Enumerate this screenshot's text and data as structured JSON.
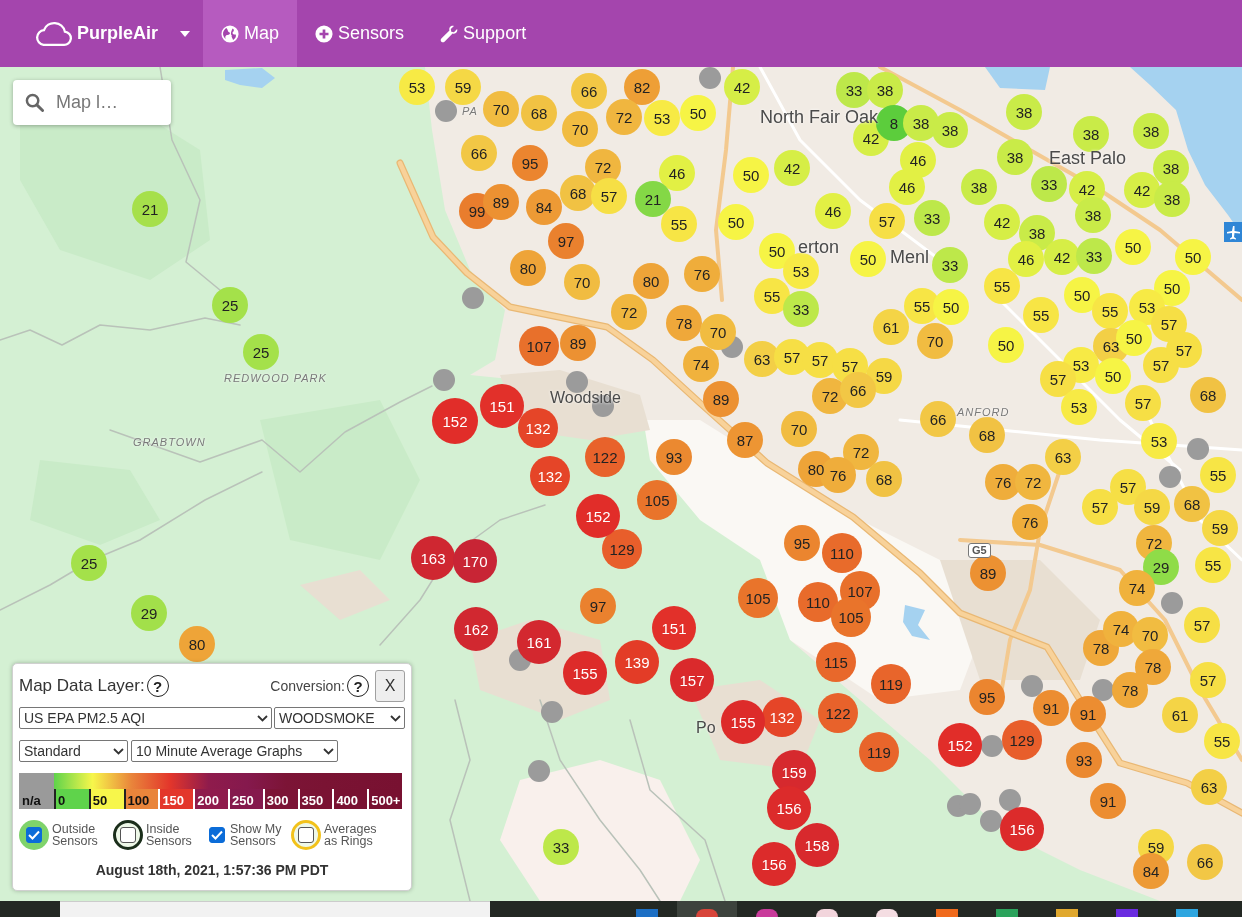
{
  "navbar": {
    "brand": "PurpleAir",
    "links": [
      {
        "label": "Map",
        "selected": true
      },
      {
        "label": "Sensors",
        "selected": false
      },
      {
        "label": "Support",
        "selected": false
      }
    ]
  },
  "search": {
    "placeholder": "Map l…"
  },
  "map": {
    "places": [
      {
        "label": "North Fair Oak",
        "kind": "city"
      },
      {
        "label": "East Palo",
        "kind": "city"
      },
      {
        "label": "erton",
        "kind": "city"
      },
      {
        "label": "Menl",
        "kind": "city"
      },
      {
        "label": "Woodside",
        "kind": "town"
      },
      {
        "label": "Po",
        "kind": "town"
      },
      {
        "label": "PA",
        "kind": "area"
      },
      {
        "label": "REDWOOD PARK",
        "kind": "area"
      },
      {
        "label": "GRABTOWN",
        "kind": "area"
      },
      {
        "label": "ANFORD",
        "kind": "area"
      }
    ],
    "route_shield": "G5",
    "markers": [
      {
        "kind": "reading",
        "reading": "53",
        "color": "#f7ea45"
      },
      {
        "kind": "reading",
        "reading": "59",
        "color": "#f5d845"
      },
      {
        "kind": "reading",
        "reading": "66",
        "color": "#f2c745"
      },
      {
        "kind": "reading",
        "reading": "82",
        "color": "#ee9f36"
      },
      {
        "kind": "offline"
      },
      {
        "kind": "reading",
        "reading": "42",
        "color": "#d6ee46"
      },
      {
        "kind": "reading",
        "reading": "33",
        "color": "#bde84a"
      },
      {
        "kind": "reading",
        "reading": "38",
        "color": "#c9eb48"
      },
      {
        "kind": "offline"
      },
      {
        "kind": "reading",
        "reading": "70",
        "color": "#f1bc41"
      },
      {
        "kind": "reading",
        "reading": "68",
        "color": "#f1c243"
      },
      {
        "kind": "reading",
        "reading": "72",
        "color": "#f0b63f"
      },
      {
        "kind": "reading",
        "reading": "53",
        "color": "#f7ea45"
      },
      {
        "kind": "reading",
        "reading": "50",
        "color": "#f6f445"
      },
      {
        "kind": "reading",
        "reading": "38",
        "color": "#c9eb48"
      },
      {
        "kind": "reading",
        "reading": "70",
        "color": "#f1bc41"
      },
      {
        "kind": "reading",
        "reading": "42",
        "color": "#d6ee46"
      },
      {
        "kind": "reading",
        "reading": "8",
        "color": "#5ccd3c"
      },
      {
        "kind": "reading",
        "reading": "38",
        "color": "#c9eb48"
      },
      {
        "kind": "reading",
        "reading": "38",
        "color": "#c9eb48"
      },
      {
        "kind": "reading",
        "reading": "38",
        "color": "#c9eb48"
      },
      {
        "kind": "reading",
        "reading": "38",
        "color": "#c9eb48"
      },
      {
        "kind": "reading",
        "reading": "66",
        "color": "#f2c745"
      },
      {
        "kind": "reading",
        "reading": "95",
        "color": "#eb852f"
      },
      {
        "kind": "reading",
        "reading": "72",
        "color": "#f0b63f"
      },
      {
        "kind": "reading",
        "reading": "46",
        "color": "#e2f044"
      },
      {
        "kind": "reading",
        "reading": "50",
        "color": "#f6f445"
      },
      {
        "kind": "reading",
        "reading": "42",
        "color": "#d6ee46"
      },
      {
        "kind": "reading",
        "reading": "46",
        "color": "#e2f044"
      },
      {
        "kind": "reading",
        "reading": "38",
        "color": "#c9eb48"
      },
      {
        "kind": "reading",
        "reading": "38",
        "color": "#c9eb48"
      },
      {
        "kind": "reading",
        "reading": "68",
        "color": "#f1c243"
      },
      {
        "kind": "reading",
        "reading": "57",
        "color": "#f6df45"
      },
      {
        "kind": "reading",
        "reading": "21",
        "color": "#84d846"
      },
      {
        "kind": "reading",
        "reading": "46",
        "color": "#e2f044"
      },
      {
        "kind": "reading",
        "reading": "38",
        "color": "#c9eb48"
      },
      {
        "kind": "reading",
        "reading": "33",
        "color": "#bde84a"
      },
      {
        "kind": "reading",
        "reading": "42",
        "color": "#d6ee46"
      },
      {
        "kind": "reading",
        "reading": "42",
        "color": "#d6ee46"
      },
      {
        "kind": "reading",
        "reading": "21",
        "color": "#a6e04b"
      },
      {
        "kind": "reading",
        "reading": "99",
        "color": "#e97d2d"
      },
      {
        "kind": "reading",
        "reading": "89",
        "color": "#ec9132"
      },
      {
        "kind": "reading",
        "reading": "84",
        "color": "#ed9a35"
      },
      {
        "kind": "reading",
        "reading": "55",
        "color": "#f7e545"
      },
      {
        "kind": "reading",
        "reading": "50",
        "color": "#f6f445"
      },
      {
        "kind": "reading",
        "reading": "46",
        "color": "#e2f044"
      },
      {
        "kind": "reading",
        "reading": "57",
        "color": "#f6df45"
      },
      {
        "kind": "reading",
        "reading": "33",
        "color": "#bde84a"
      },
      {
        "kind": "reading",
        "reading": "42",
        "color": "#d6ee46"
      },
      {
        "kind": "reading",
        "reading": "38",
        "color": "#c9eb48"
      },
      {
        "kind": "reading",
        "reading": "38",
        "color": "#c9eb48"
      },
      {
        "kind": "reading",
        "reading": "80",
        "color": "#eea438"
      },
      {
        "kind": "reading",
        "reading": "97",
        "color": "#ea812e"
      },
      {
        "kind": "reading",
        "reading": "50",
        "color": "#f6f445"
      },
      {
        "kind": "reading",
        "reading": "50",
        "color": "#f6f445"
      },
      {
        "kind": "reading",
        "reading": "33",
        "color": "#bde84a"
      },
      {
        "kind": "reading",
        "reading": "38",
        "color": "#c9eb48"
      },
      {
        "kind": "reading",
        "reading": "46",
        "color": "#e2f044"
      },
      {
        "kind": "reading",
        "reading": "42",
        "color": "#d6ee46"
      },
      {
        "kind": "reading",
        "reading": "33",
        "color": "#bde84a"
      },
      {
        "kind": "reading",
        "reading": "50",
        "color": "#f6f445"
      },
      {
        "kind": "reading",
        "reading": "50",
        "color": "#f6f445"
      },
      {
        "kind": "offline"
      },
      {
        "kind": "reading",
        "reading": "70",
        "color": "#f1bc41"
      },
      {
        "kind": "reading",
        "reading": "80",
        "color": "#eea438"
      },
      {
        "kind": "reading",
        "reading": "76",
        "color": "#efad3b"
      },
      {
        "kind": "reading",
        "reading": "55",
        "color": "#f7e545"
      },
      {
        "kind": "reading",
        "reading": "53",
        "color": "#f7ea45"
      },
      {
        "kind": "reading",
        "reading": "55",
        "color": "#f7e545"
      },
      {
        "kind": "reading",
        "reading": "50",
        "color": "#f6f445"
      },
      {
        "kind": "reading",
        "reading": "50",
        "color": "#f6f445"
      },
      {
        "kind": "reading",
        "reading": "25",
        "color": "#a4e14a"
      },
      {
        "kind": "reading",
        "reading": "72",
        "color": "#f0b63f"
      },
      {
        "kind": "reading",
        "reading": "33",
        "color": "#bde84a"
      },
      {
        "kind": "reading",
        "reading": "55",
        "color": "#f7e545"
      },
      {
        "kind": "reading",
        "reading": "50",
        "color": "#f6f445"
      },
      {
        "kind": "reading",
        "reading": "55",
        "color": "#f7e545"
      },
      {
        "kind": "reading",
        "reading": "55",
        "color": "#f7e545"
      },
      {
        "kind": "reading",
        "reading": "53",
        "color": "#f7ea45"
      },
      {
        "kind": "reading",
        "reading": "78",
        "color": "#efa83a"
      },
      {
        "kind": "reading",
        "reading": "70",
        "color": "#f1bc41"
      },
      {
        "kind": "reading",
        "reading": "61",
        "color": "#f4d446"
      },
      {
        "kind": "reading",
        "reading": "57",
        "color": "#f6df45"
      },
      {
        "kind": "reading",
        "reading": "25",
        "color": "#a4e14a"
      },
      {
        "kind": "reading",
        "reading": "107",
        "color": "#e8702b"
      },
      {
        "kind": "reading",
        "reading": "89",
        "color": "#ec9132"
      },
      {
        "kind": "offline"
      },
      {
        "kind": "reading",
        "reading": "70",
        "color": "#f1bc41"
      },
      {
        "kind": "reading",
        "reading": "50",
        "color": "#f6f445"
      },
      {
        "kind": "reading",
        "reading": "63",
        "color": "#f3cf46"
      },
      {
        "kind": "reading",
        "reading": "50",
        "color": "#f6f445"
      },
      {
        "kind": "reading",
        "reading": "74",
        "color": "#f0b23d"
      },
      {
        "kind": "reading",
        "reading": "63",
        "color": "#f3cf46"
      },
      {
        "kind": "reading",
        "reading": "57",
        "color": "#f6df45"
      },
      {
        "kind": "reading",
        "reading": "57",
        "color": "#f6df45"
      },
      {
        "kind": "reading",
        "reading": "57",
        "color": "#f6df45"
      },
      {
        "kind": "reading",
        "reading": "53",
        "color": "#f7ea45"
      },
      {
        "kind": "reading",
        "reading": "57",
        "color": "#f6df45"
      },
      {
        "kind": "reading",
        "reading": "57",
        "color": "#f6df45"
      },
      {
        "kind": "offline"
      },
      {
        "kind": "offline"
      },
      {
        "kind": "reading",
        "reading": "59",
        "color": "#f5d845"
      },
      {
        "kind": "reading",
        "reading": "57",
        "color": "#f6df45"
      },
      {
        "kind": "reading",
        "reading": "50",
        "color": "#f6f445"
      },
      {
        "kind": "reading",
        "reading": "151",
        "color": "#e2302a"
      },
      {
        "kind": "offline"
      },
      {
        "kind": "reading",
        "reading": "89",
        "color": "#ec9132"
      },
      {
        "kind": "reading",
        "reading": "72",
        "color": "#f0b63f"
      },
      {
        "kind": "reading",
        "reading": "66",
        "color": "#f2c745"
      },
      {
        "kind": "reading",
        "reading": "53",
        "color": "#f7ea45"
      },
      {
        "kind": "reading",
        "reading": "57",
        "color": "#f6df45"
      },
      {
        "kind": "reading",
        "reading": "68",
        "color": "#f1c243"
      },
      {
        "kind": "reading",
        "reading": "152",
        "color": "#e12d29"
      },
      {
        "kind": "reading",
        "reading": "132",
        "color": "#e54528"
      },
      {
        "kind": "reading",
        "reading": "87",
        "color": "#ed9533"
      },
      {
        "kind": "reading",
        "reading": "70",
        "color": "#f1bc41"
      },
      {
        "kind": "reading",
        "reading": "66",
        "color": "#f2c745"
      },
      {
        "kind": "reading",
        "reading": "68",
        "color": "#f1c243"
      },
      {
        "kind": "reading",
        "reading": "53",
        "color": "#f7ea45"
      },
      {
        "kind": "reading",
        "reading": "122",
        "color": "#e8622b"
      },
      {
        "kind": "reading",
        "reading": "93",
        "color": "#eb8930"
      },
      {
        "kind": "reading",
        "reading": "72",
        "color": "#f0b63f"
      },
      {
        "kind": "reading",
        "reading": "63",
        "color": "#f3cf46"
      },
      {
        "kind": "offline"
      },
      {
        "kind": "reading",
        "reading": "132",
        "color": "#e54528"
      },
      {
        "kind": "reading",
        "reading": "80",
        "color": "#eea438"
      },
      {
        "kind": "reading",
        "reading": "76",
        "color": "#efad3b"
      },
      {
        "kind": "reading",
        "reading": "68",
        "color": "#f1c243"
      },
      {
        "kind": "reading",
        "reading": "76",
        "color": "#efad3b"
      },
      {
        "kind": "reading",
        "reading": "72",
        "color": "#f0b63f"
      },
      {
        "kind": "reading",
        "reading": "57",
        "color": "#f6df45"
      },
      {
        "kind": "offline"
      },
      {
        "kind": "reading",
        "reading": "55",
        "color": "#f7e545"
      },
      {
        "kind": "reading",
        "reading": "152",
        "color": "#e12d29"
      },
      {
        "kind": "reading",
        "reading": "105",
        "color": "#e9742b"
      },
      {
        "kind": "reading",
        "reading": "76",
        "color": "#efad3b"
      },
      {
        "kind": "reading",
        "reading": "57",
        "color": "#f6df45"
      },
      {
        "kind": "reading",
        "reading": "59",
        "color": "#f5d845"
      },
      {
        "kind": "reading",
        "reading": "68",
        "color": "#f1c243"
      },
      {
        "kind": "reading",
        "reading": "59",
        "color": "#f5d845"
      },
      {
        "kind": "reading",
        "reading": "25",
        "color": "#a4e14a"
      },
      {
        "kind": "reading",
        "reading": "163",
        "color": "#cf2731"
      },
      {
        "kind": "reading",
        "reading": "170",
        "color": "#c82535"
      },
      {
        "kind": "reading",
        "reading": "129",
        "color": "#e85e2b"
      },
      {
        "kind": "reading",
        "reading": "95",
        "color": "#eb852f"
      },
      {
        "kind": "reading",
        "reading": "110",
        "color": "#e86b2b"
      },
      {
        "kind": "reading",
        "reading": "89",
        "color": "#ec9132"
      },
      {
        "kind": "reading",
        "reading": "72",
        "color": "#f0b63f"
      },
      {
        "kind": "reading",
        "reading": "29",
        "color": "#8fdc48"
      },
      {
        "kind": "reading",
        "reading": "55",
        "color": "#f7e545"
      },
      {
        "kind": "reading",
        "reading": "29",
        "color": "#a2e04a"
      },
      {
        "kind": "reading",
        "reading": "97",
        "color": "#ea812e"
      },
      {
        "kind": "reading",
        "reading": "105",
        "color": "#e9742b"
      },
      {
        "kind": "reading",
        "reading": "110",
        "color": "#e86b2b"
      },
      {
        "kind": "reading",
        "reading": "107",
        "color": "#e8702b"
      },
      {
        "kind": "reading",
        "reading": "105",
        "color": "#e9742b"
      },
      {
        "kind": "reading",
        "reading": "74",
        "color": "#f0b23d"
      },
      {
        "kind": "reading",
        "reading": "80",
        "color": "#eea438"
      },
      {
        "kind": "reading",
        "reading": "162",
        "color": "#d12830"
      },
      {
        "kind": "reading",
        "reading": "161",
        "color": "#d3282f"
      },
      {
        "kind": "reading",
        "reading": "151",
        "color": "#e2302a"
      },
      {
        "kind": "reading",
        "reading": "78",
        "color": "#efa83a"
      },
      {
        "kind": "reading",
        "reading": "74",
        "color": "#f0b23d"
      },
      {
        "kind": "reading",
        "reading": "70",
        "color": "#f1bc41"
      },
      {
        "kind": "offline"
      },
      {
        "kind": "reading",
        "reading": "57",
        "color": "#f6df45"
      },
      {
        "kind": "offline"
      },
      {
        "kind": "reading",
        "reading": "155",
        "color": "#dd2b2a"
      },
      {
        "kind": "reading",
        "reading": "139",
        "color": "#e33c27"
      },
      {
        "kind": "reading",
        "reading": "157",
        "color": "#da2a2c"
      },
      {
        "kind": "reading",
        "reading": "115",
        "color": "#e8682b"
      },
      {
        "kind": "reading",
        "reading": "119",
        "color": "#e8652b"
      },
      {
        "kind": "reading",
        "reading": "95",
        "color": "#eb852f"
      },
      {
        "kind": "offline"
      },
      {
        "kind": "offline"
      },
      {
        "kind": "reading",
        "reading": "78",
        "color": "#efa83a"
      },
      {
        "kind": "reading",
        "reading": "78",
        "color": "#efa83a"
      },
      {
        "kind": "reading",
        "reading": "57",
        "color": "#f6df45"
      },
      {
        "kind": "offline"
      },
      {
        "kind": "reading",
        "reading": "155",
        "color": "#dd2b2a"
      },
      {
        "kind": "reading",
        "reading": "132",
        "color": "#e54528"
      },
      {
        "kind": "reading",
        "reading": "122",
        "color": "#e8622b"
      },
      {
        "kind": "reading",
        "reading": "91",
        "color": "#ec8d31"
      },
      {
        "kind": "reading",
        "reading": "91",
        "color": "#ec8d31"
      },
      {
        "kind": "reading",
        "reading": "61",
        "color": "#f4d446"
      },
      {
        "kind": "reading",
        "reading": "119",
        "color": "#e8652b"
      },
      {
        "kind": "reading",
        "reading": "152",
        "color": "#e12d29"
      },
      {
        "kind": "offline"
      },
      {
        "kind": "reading",
        "reading": "129",
        "color": "#e85e2b"
      },
      {
        "kind": "reading",
        "reading": "93",
        "color": "#eb8930"
      },
      {
        "kind": "reading",
        "reading": "55",
        "color": "#f7e545"
      },
      {
        "kind": "offline"
      },
      {
        "kind": "reading",
        "reading": "159",
        "color": "#d6292e"
      },
      {
        "kind": "reading",
        "reading": "63",
        "color": "#f3cf46"
      },
      {
        "kind": "reading",
        "reading": "156",
        "color": "#dc2b2b"
      },
      {
        "kind": "offline"
      },
      {
        "kind": "offline"
      },
      {
        "kind": "offline"
      },
      {
        "kind": "offline"
      },
      {
        "kind": "reading",
        "reading": "91",
        "color": "#ec8d31"
      },
      {
        "kind": "reading",
        "reading": "156",
        "color": "#dc2b2b"
      },
      {
        "kind": "reading",
        "reading": "33",
        "color": "#bde84a"
      },
      {
        "kind": "reading",
        "reading": "158",
        "color": "#d8292d"
      },
      {
        "kind": "reading",
        "reading": "59",
        "color": "#f5d845"
      },
      {
        "kind": "reading",
        "reading": "156",
        "color": "#dc2b2b"
      },
      {
        "kind": "reading",
        "reading": "84",
        "color": "#ed9a35"
      },
      {
        "kind": "reading",
        "reading": "66",
        "color": "#f2c745"
      }
    ]
  },
  "legend_panel": {
    "title": "Map Data Layer:",
    "title_help": "?",
    "conversion_label": "Conversion:",
    "conversion_help": "?",
    "close": "X",
    "selects": [
      {
        "value": "US EPA PM2.5 AQI"
      },
      {
        "value": "WOODSMOKE"
      },
      {
        "value": "Standard"
      },
      {
        "value": "10 Minute Average Graphs"
      }
    ],
    "scale": [
      {
        "kind": "missing",
        "label": "n/a",
        "color": "#9a9a9a"
      },
      {
        "kind": "level",
        "label": "0",
        "color": "#5fd34b"
      },
      {
        "kind": "level",
        "label": "50",
        "color": "#f7f64b"
      },
      {
        "kind": "level",
        "label": "100",
        "color": "#e9853b"
      },
      {
        "kind": "level",
        "label": "150",
        "color": "#e3362b"
      },
      {
        "kind": "level",
        "label": "200",
        "color": "#8f1b4c"
      },
      {
        "kind": "level",
        "label": "250",
        "color": "#85194d"
      },
      {
        "kind": "level",
        "label": "300",
        "color": "#7c1436"
      },
      {
        "kind": "level",
        "label": "350",
        "color": "#7a1333"
      },
      {
        "kind": "level",
        "label": "400",
        "color": "#791232"
      },
      {
        "kind": "level",
        "label": "500+",
        "color": "#781131"
      }
    ],
    "toggles": [
      {
        "label": "Outside Sensors",
        "checked": true,
        "kind": "disc",
        "color": "#7fd36b"
      },
      {
        "label": "Inside Sensors",
        "checked": false,
        "kind": "ring",
        "color": "#1b2e1b"
      },
      {
        "label": "Show My Sensors",
        "checked": true,
        "kind": "plain"
      },
      {
        "label": "Averages as Rings",
        "checked": false,
        "kind": "ring",
        "color": "#f2c21b"
      }
    ],
    "timestamp": "August 18th, 2021, 1:57:36 PM PDT"
  },
  "taskbar": {
    "apps": [
      {
        "kind": "square",
        "color": "#1c6fc4",
        "selected": false
      },
      {
        "kind": "round",
        "color": "#d8453a",
        "selected": true
      },
      {
        "kind": "round",
        "color": "#c93b9b",
        "selected": false
      },
      {
        "kind": "round",
        "color": "#f2d5dc",
        "selected": false
      },
      {
        "kind": "round",
        "color": "#f4dde2",
        "selected": false
      },
      {
        "kind": "square",
        "color": "#f06a1c",
        "selected": false
      },
      {
        "kind": "square",
        "color": "#2ba35c",
        "selected": false
      },
      {
        "kind": "square",
        "color": "#e0a82e",
        "selected": false
      },
      {
        "kind": "square",
        "color": "#6a2ce0",
        "selected": false
      },
      {
        "kind": "square",
        "color": "#2ea6e0",
        "selected": false
      }
    ]
  }
}
